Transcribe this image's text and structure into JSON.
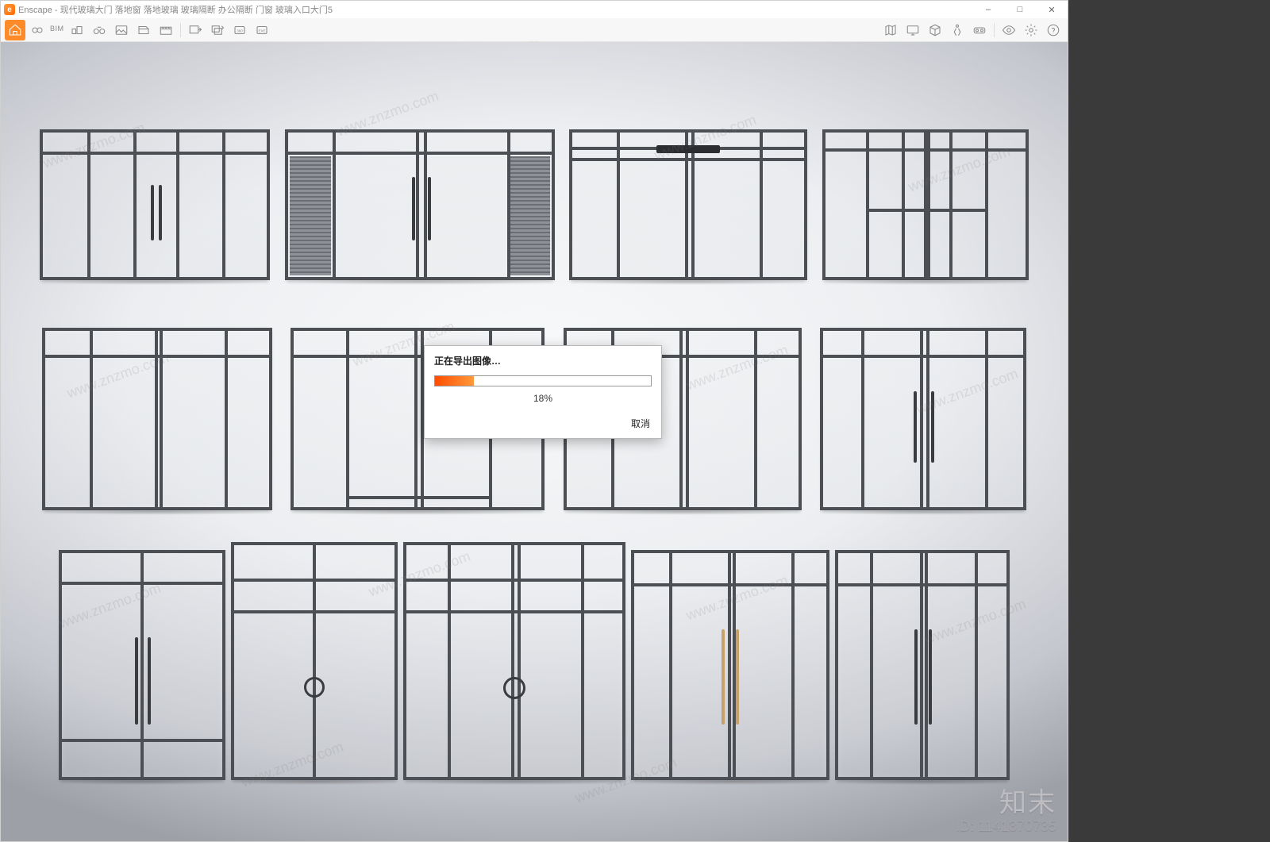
{
  "window": {
    "app_name": "Enscape",
    "title": "Enscape - 现代玻璃大门 落地窗 落地玻璃 玻璃隔断 办公隔断 门窗 玻璃入口大门5",
    "controls": {
      "minimize": "–",
      "maximize": "□",
      "close": "✕"
    }
  },
  "toolbar": {
    "bim_label": "BIM",
    "icons": {
      "home": "home-icon",
      "link": "link-icon",
      "bim_toggle": "bim-toggle-icon",
      "binoculars": "binoculars-icon",
      "image": "image-icon",
      "cube_left": "orbit-icon",
      "clapper": "video-icon",
      "export_image": "export-image-icon",
      "export_batch": "export-batch-icon",
      "pano": "panorama-icon",
      "exe": "exe-export-icon",
      "map": "minimap-icon",
      "monitor": "display-icon",
      "package": "asset-library-icon",
      "walk": "walk-mode-icon",
      "vr": "vr-icon",
      "eye": "visual-settings-icon",
      "settings": "settings-icon",
      "help": "help-icon"
    },
    "expand_chevron": "⌄"
  },
  "dialog": {
    "message": "正在导出图像…",
    "progress_percent": 18,
    "progress_label": "18%",
    "cancel_label": "取消"
  },
  "watermark": {
    "brand": "知末",
    "id_label": "ID: 1141370735",
    "repeat_text": "www.znzmo.com"
  }
}
